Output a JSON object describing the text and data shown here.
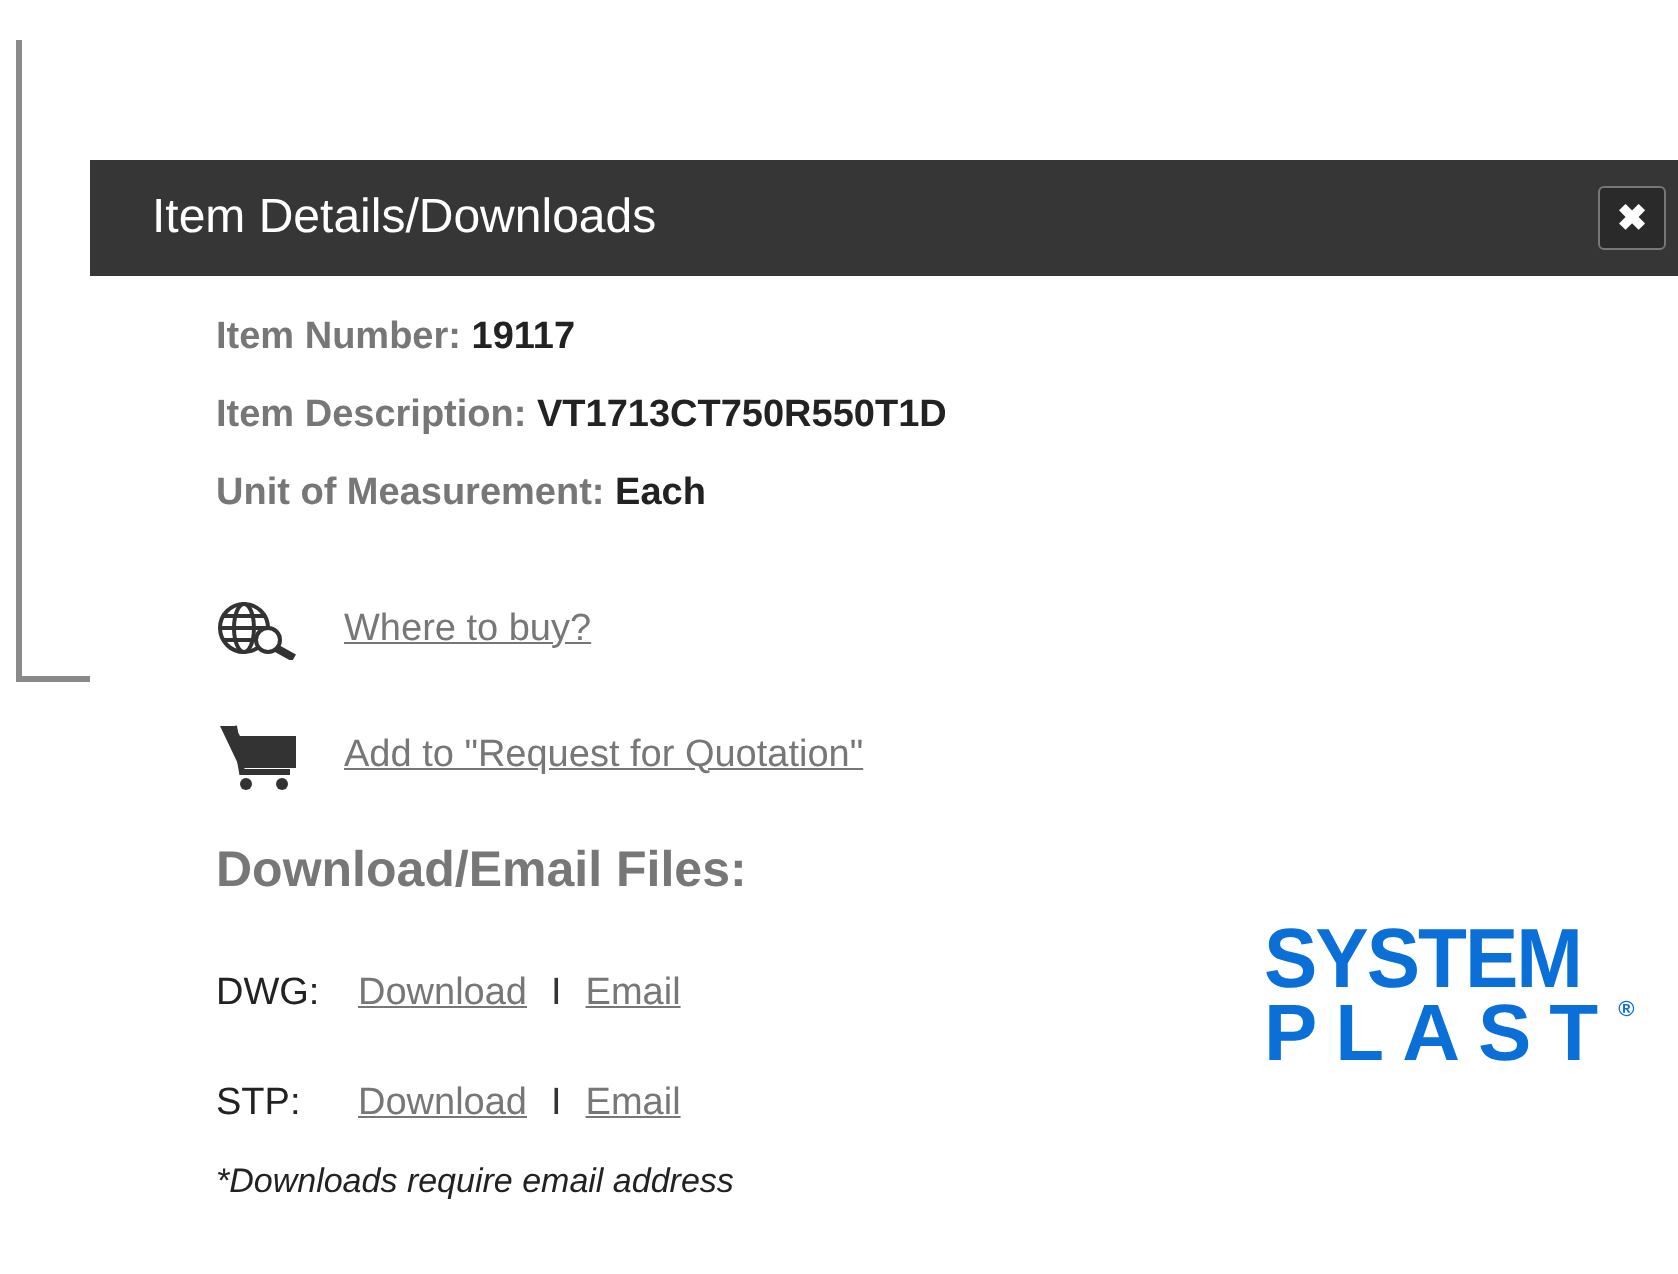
{
  "dialog": {
    "title": "Item Details/Downloads",
    "close": "✖"
  },
  "details": [
    {
      "label": "Item Number:",
      "value": "19117"
    },
    {
      "label": "Item Description:",
      "value": "VT1713CT750R550T1D"
    },
    {
      "label": "Unit of Measurement:",
      "value": "Each"
    }
  ],
  "actions": [
    {
      "kind": "globe",
      "label": "Where to buy?"
    },
    {
      "kind": "cart",
      "label": "Add to \"Request for Quotation\""
    }
  ],
  "files_heading": "Download/Email Files:",
  "files": [
    {
      "type": "DWG:",
      "download": "Download",
      "separator": "I",
      "email": "Email"
    },
    {
      "type": "STP:",
      "download": "Download",
      "separator": "I",
      "email": "Email"
    }
  ],
  "note": "*Downloads require email address",
  "logo": {
    "line_1": "SYSTEM",
    "line_2": "PLAST",
    "mark": "®"
  }
}
